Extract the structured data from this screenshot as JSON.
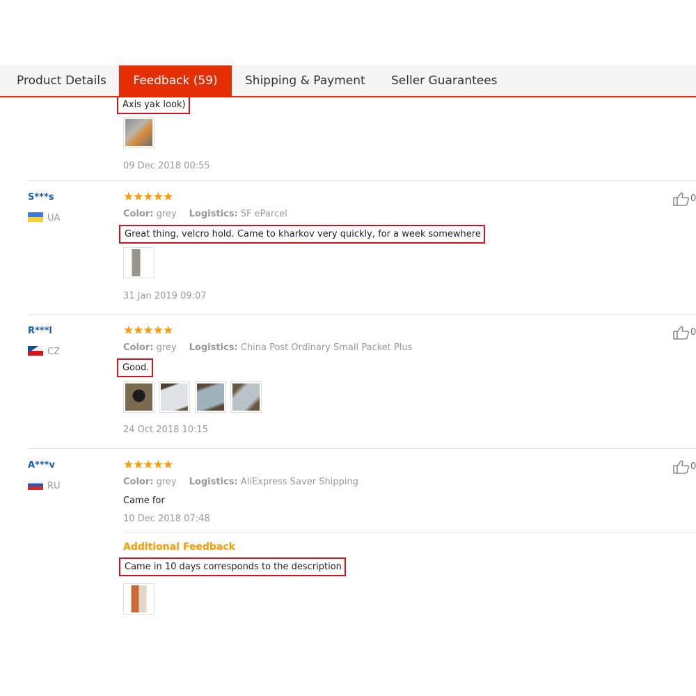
{
  "tabs": [
    {
      "label": "Product Details",
      "active": false
    },
    {
      "label": "Feedback (59)",
      "active": true
    },
    {
      "label": "Shipping & Payment",
      "active": false
    },
    {
      "label": "Seller Guarantees",
      "active": false
    }
  ],
  "colors": {
    "accent": "#e62e04",
    "star": "#ff9a00",
    "highlight_border": "#d0161c",
    "username": "#1a5fb4"
  },
  "feedback": {
    "partial": {
      "text": "Axis yak look)",
      "date": "09 Dec 2018 00:55"
    },
    "reviews": [
      {
        "user": "S***s",
        "country": "UA",
        "stars": "★★★★★",
        "color_label": "Color:",
        "color_value": "grey",
        "logistics_label": "Logistics:",
        "logistics_value": "SF eParcel",
        "text": "Great thing, velcro hold. Came to kharkov very quickly, for a week somewhere",
        "date": "31 Jan 2019 09:07",
        "like_count": "0"
      },
      {
        "user": "R***l",
        "country": "CZ",
        "stars": "★★★★★",
        "color_label": "Color:",
        "color_value": "grey",
        "logistics_label": "Logistics:",
        "logistics_value": "China Post Ordinary Small Packet Plus",
        "text": "Good.",
        "date": "24 Oct 2018 10:15",
        "like_count": "0"
      },
      {
        "user": "A***v",
        "country": "RU",
        "stars": "★★★★★",
        "color_label": "Color:",
        "color_value": "grey",
        "logistics_label": "Logistics:",
        "logistics_value": "AliExpress Saver Shipping",
        "text": "Came for",
        "date": "10 Dec 2018 07:48",
        "additional_label": "Additional Feedback",
        "additional_text": "Came in 10 days corresponds to the description",
        "like_count": "0"
      }
    ]
  },
  "icons": {
    "like": "thumbs-up-icon"
  }
}
